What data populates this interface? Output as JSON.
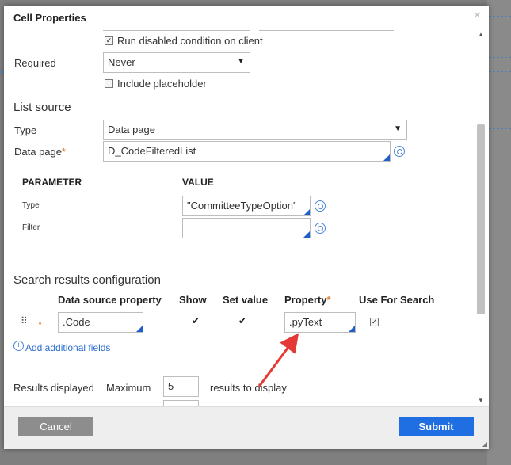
{
  "dialog": {
    "title": "Cell Properties",
    "close_label": "×"
  },
  "form": {
    "run_disabled_label": "Run disabled condition on client",
    "required_label": "Required",
    "required_value": "Never",
    "include_placeholder_label": "Include placeholder",
    "list_source_title": "List source",
    "type_label": "Type",
    "type_value": "Data page",
    "data_page_label": "Data page",
    "data_page_value": "D_CodeFilteredList",
    "param_header": "PARAMETER",
    "value_header": "VALUE",
    "params": [
      {
        "name": "Type",
        "value": "\"CommitteeTypeOption\""
      },
      {
        "name": "Filter",
        "value": ""
      }
    ],
    "search_title": "Search results configuration",
    "columns": {
      "data_source": "Data source property",
      "show": "Show",
      "set_value": "Set value",
      "property": "Property",
      "use_for_search": "Use For Search"
    },
    "row": {
      "data_source_value": ".Code",
      "property_value": ".pyText"
    },
    "add_fields_link": "Add additional fields",
    "results_displayed_label": "Results displayed",
    "maximum_label": "Maximum",
    "maximum_value": "5",
    "results_suffix": "results to display"
  },
  "footer": {
    "cancel_label": "Cancel",
    "submit_label": "Submit"
  },
  "colors": {
    "accent": "#1f6fe3",
    "required_star": "#e07b2c",
    "annotation_arrow": "#e53935"
  },
  "icons": [
    "close-icon",
    "gear-target-icon",
    "plus-circle-icon",
    "drag-handle-icon",
    "checkbox-icon"
  ]
}
